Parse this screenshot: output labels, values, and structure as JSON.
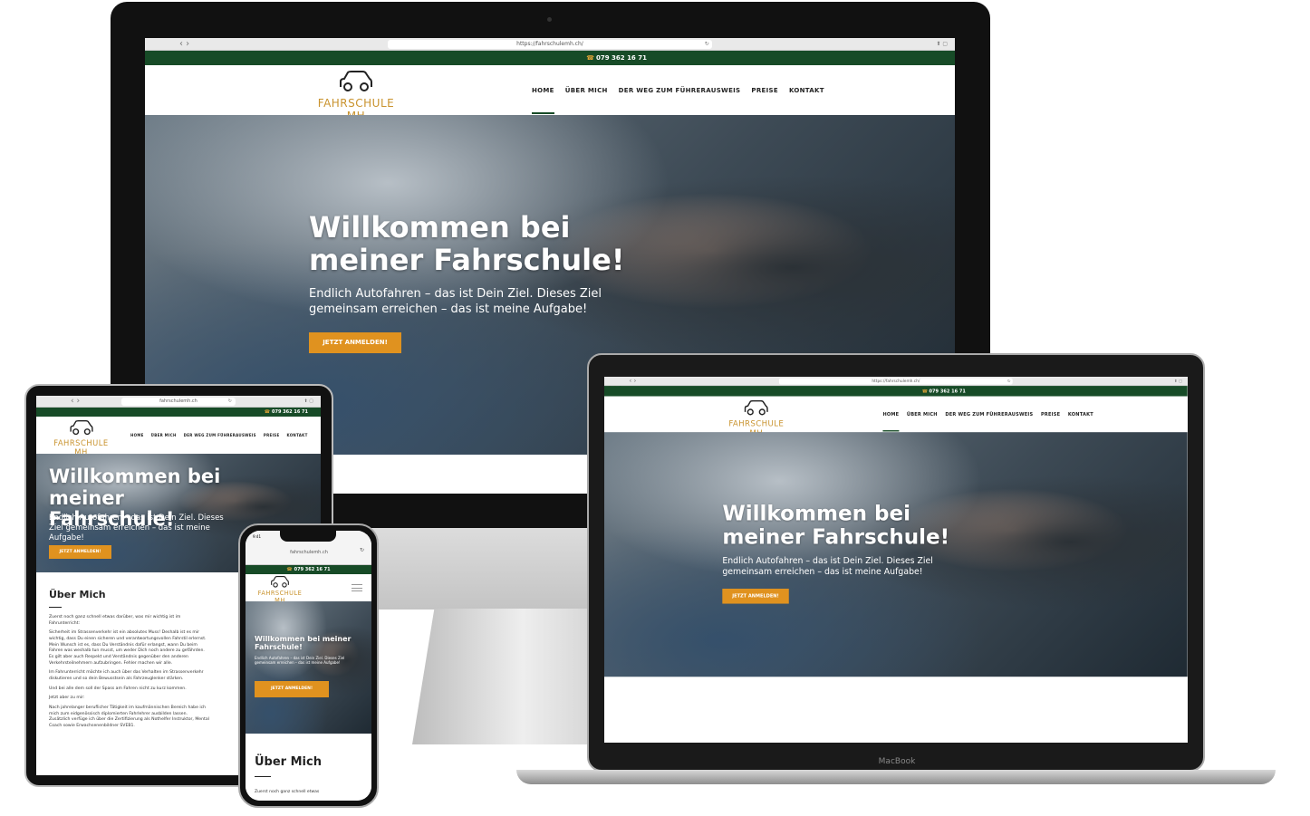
{
  "site": {
    "url_full": "https://fahrschulemh.ch/",
    "url_short": "fahrschulemh.ch",
    "phone": "079 362 16 71",
    "logo": {
      "brand": "FAHRSCHULE MH",
      "sub": "M. HUBER DIPL. FAHRLEHRER"
    },
    "nav": [
      "HOME",
      "ÜBER MICH",
      "DER WEG ZUM FÜHRERAUSWEIS",
      "PREISE",
      "KONTAKT"
    ],
    "hero": {
      "title": "Willkommen bei meiner Fahrschule!",
      "subtitle": "Endlich Autofahren – das ist Dein Ziel. Dieses Ziel gemeinsam erreichen – das ist meine Aufgabe!",
      "cta": "JETZT ANMELDEN!"
    },
    "about": {
      "title": "Über Mich",
      "paragraphs": [
        "Zuerst noch ganz schnell etwas darüber, was mir wichtig ist im Fahrunterricht:",
        "Sicherheit im Strassenverkehr ist ein absolutes Muss! Deshalb ist es mir wichtig, dass Du einen sicheren und verantwortungsvollen Fahrstil erlernst. Mein Wunsch ist es, dass Du Verständnis dafür erlangst, wann Du beim Fahren was weshalb tun musst, um weder Dich noch andere zu gefährden. Es gilt aber auch Respekt und Verständnis gegenüber den anderen Verkehrsteilnehmern aufzubringen. Fehler machen wir alle.",
        "Im Fahrunterricht möchte ich auch über das Verhalten im Strassenverkehr diskutieren und so dein Bewusstsein als Fahrzeuglenker stärken.",
        "Und bei alle dem soll der Spass am Fahren nicht zu kurz kommen.",
        "Jetzt aber zu mir:",
        "Nach jahrelanger beruflicher Tätigkeit im kaufmännischen Bereich habe ich mich zum eidgenössisch diplomierten Fahrlehrer ausbilden lassen. Zusätzlich verfüge ich über die Zertifizierung als Nothelfer Instruktor, Mental Coach sowie Erwachsenenbildner SVEB1."
      ],
      "phone_teaser": "Zuerst noch ganz schnell etwas"
    },
    "status_time": "9:41"
  },
  "devices": {
    "laptop_label": "MacBook"
  },
  "colors": {
    "green": "#174b27",
    "accent": "#e0921f",
    "logo_gold": "#c9932e"
  },
  "icons": [
    "apple-logo-icon",
    "car-logo-icon",
    "phone-icon",
    "hamburger-menu-icon",
    "reload-icon",
    "back-icon",
    "forward-icon",
    "share-icon"
  ]
}
